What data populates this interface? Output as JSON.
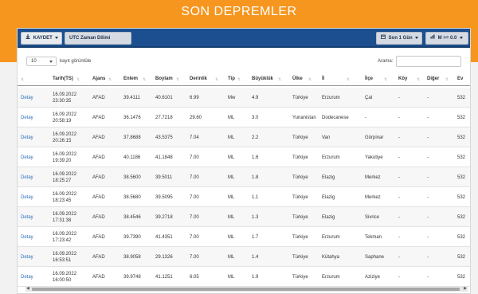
{
  "page_title": "SON DEPREMLER",
  "toolbar": {
    "save_label": "KAYDET",
    "utc_label": "UTC Zaman Dilimi",
    "period_label": "Son 1 Gün",
    "magnitude_label": "M >= 0.0"
  },
  "table_controls": {
    "page_length": "10",
    "page_length_suffix": "kayıt görüntüle",
    "search_label": "Arama:",
    "search_value": ""
  },
  "columns": [
    "Tarih(TS)",
    "Ajans",
    "Enlem",
    "Boylam",
    "Derinlik",
    "Tip",
    "Büyüklük",
    "Ülke",
    "İl",
    "İlçe",
    "Köy",
    "Diğer",
    "Ev"
  ],
  "rows": [
    {
      "action": "Detay",
      "date": "16.09.2022",
      "time": "23:30:35",
      "agency": "AFAD",
      "lat": "39.4111",
      "lon": "40.6101",
      "depth": "6.99",
      "type": "Mw",
      "mag": "4.9",
      "country": "Türkiye",
      "province": "Erzurum",
      "district": "Çat",
      "village": "-",
      "other": "-",
      "ev": "532"
    },
    {
      "action": "Detay",
      "date": "16.09.2022",
      "time": "20:58:19",
      "agency": "AFAD",
      "lat": "36.1476",
      "lon": "27.7218",
      "depth": "29.60",
      "type": "ML",
      "mag": "3.0",
      "country": "Yunanistan",
      "province": "Dodecanese",
      "district": "-",
      "village": "-",
      "other": "-",
      "ev": "532"
    },
    {
      "action": "Detay",
      "date": "16.09.2022",
      "time": "20:26:15",
      "agency": "AFAD",
      "lat": "37.8688",
      "lon": "43.5375",
      "depth": "7.04",
      "type": "ML",
      "mag": "2.2",
      "country": "Türkiye",
      "province": "Van",
      "district": "Gürpinar",
      "village": "-",
      "other": "-",
      "ev": "532"
    },
    {
      "action": "Detay",
      "date": "16.09.2022",
      "time": "19:39:20",
      "agency": "AFAD",
      "lat": "40.1186",
      "lon": "41.1848",
      "depth": "7.00",
      "type": "ML",
      "mag": "1.6",
      "country": "Türkiye",
      "province": "Erzurum",
      "district": "Yakutiye",
      "village": "-",
      "other": "-",
      "ev": "532"
    },
    {
      "action": "Detay",
      "date": "16.09.2022",
      "time": "18:25:27",
      "agency": "AFAD",
      "lat": "38.5600",
      "lon": "39.5011",
      "depth": "7.00",
      "type": "ML",
      "mag": "1.8",
      "country": "Türkiye",
      "province": "Elazig",
      "district": "Merkez",
      "village": "-",
      "other": "-",
      "ev": "532"
    },
    {
      "action": "Detay",
      "date": "16.09.2022",
      "time": "18:23:45",
      "agency": "AFAD",
      "lat": "38.5680",
      "lon": "39.5095",
      "depth": "7.00",
      "type": "ML",
      "mag": "1.1",
      "country": "Türkiye",
      "province": "Elazig",
      "district": "Merkez",
      "village": "-",
      "other": "-",
      "ev": "532"
    },
    {
      "action": "Detay",
      "date": "16.09.2022",
      "time": "17:31:38",
      "agency": "AFAD",
      "lat": "38.4546",
      "lon": "39.2718",
      "depth": "7.00",
      "type": "ML",
      "mag": "1.3",
      "country": "Türkiye",
      "province": "Elazig",
      "district": "Sivrice",
      "village": "-",
      "other": "-",
      "ev": "532"
    },
    {
      "action": "Detay",
      "date": "16.09.2022",
      "time": "17:23:42",
      "agency": "AFAD",
      "lat": "39.7390",
      "lon": "41.4351",
      "depth": "7.00",
      "type": "ML",
      "mag": "1.7",
      "country": "Türkiye",
      "province": "Erzurum",
      "district": "Tekman",
      "village": "-",
      "other": "-",
      "ev": "532"
    },
    {
      "action": "Detay",
      "date": "16.09.2022",
      "time": "16:53:51",
      "agency": "AFAD",
      "lat": "38.9058",
      "lon": "29.1326",
      "depth": "7.00",
      "type": "ML",
      "mag": "1.4",
      "country": "Türkiye",
      "province": "Kütahya",
      "district": "Saphane",
      "village": "-",
      "other": "-",
      "ev": "532"
    },
    {
      "action": "Detay",
      "date": "16.09.2022",
      "time": "16:00:50",
      "agency": "AFAD",
      "lat": "39.9748",
      "lon": "41.1251",
      "depth": "6.05",
      "type": "ML",
      "mag": "1.9",
      "country": "Türkiye",
      "province": "Erzurum",
      "district": "Aziziye",
      "village": "-",
      "other": "-",
      "ev": "532"
    }
  ],
  "icons": {
    "save": "download-icon",
    "utc": "",
    "period": "calendar-icon",
    "magnitude": "bar-chart-icon"
  }
}
